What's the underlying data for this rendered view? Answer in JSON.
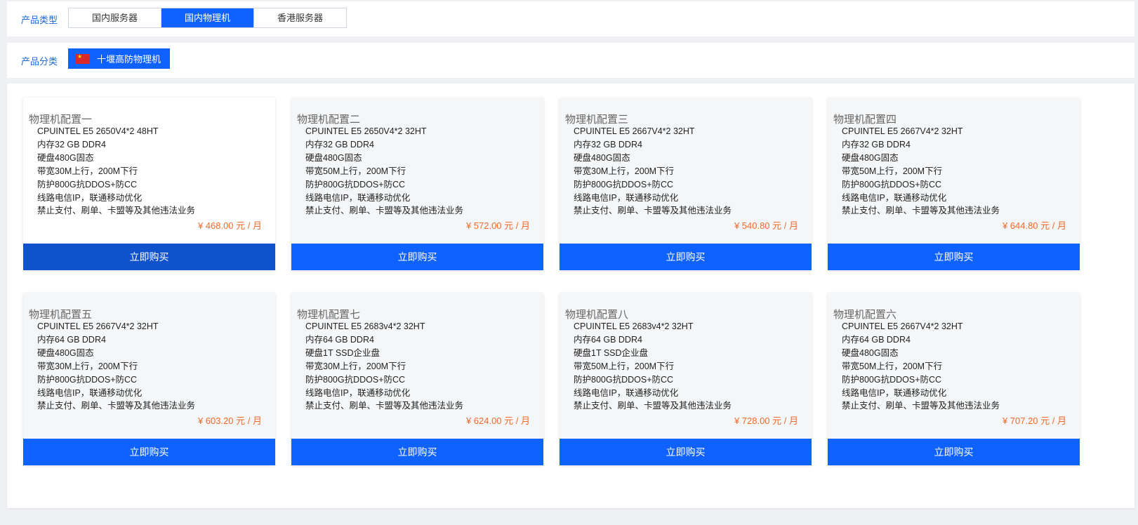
{
  "product_type": {
    "label": "产品类型",
    "tabs": [
      {
        "label": "国内服务器",
        "active": false
      },
      {
        "label": "国内物理机",
        "active": true
      },
      {
        "label": "香港服务器",
        "active": false
      }
    ]
  },
  "product_category": {
    "label": "产品分类",
    "selected": {
      "label": "十堰高防物理机",
      "icon": "china-flag-icon"
    }
  },
  "colors": {
    "accent": "#0f62fe",
    "price": "#f26a2a",
    "label": "#1e6ad6"
  },
  "cards": [
    {
      "title": "物理机配置一",
      "specs": [
        "CPUINTEL E5 2650V4*2 48HT",
        "内存32 GB DDR4",
        "硬盘480G固态",
        "带宽30M上行，200M下行",
        "防护800G抗DDOS+防CC",
        "线路电信IP，联通移动优化",
        "禁止支付、刷单、卡盟等及其他违法业务"
      ],
      "price": "¥ 468.00 元 / 月",
      "buy_label": "立即购买"
    },
    {
      "title": "物理机配置二",
      "specs": [
        "CPUINTEL E5 2650V4*2 32HT",
        "内存32 GB DDR4",
        "硬盘480G固态",
        "带宽50M上行，200M下行",
        "防护800G抗DDOS+防CC",
        "线路电信IP，联通移动优化",
        "禁止支付、刷单、卡盟等及其他违法业务"
      ],
      "price": "¥ 572.00 元 / 月",
      "buy_label": "立即购买"
    },
    {
      "title": "物理机配置三",
      "specs": [
        "CPUINTEL E5 2667V4*2 32HT",
        "内存32 GB DDR4",
        "硬盘480G固态",
        "带宽30M上行，200M下行",
        "防护800G抗DDOS+防CC",
        "线路电信IP，联通移动优化",
        "禁止支付、刷单、卡盟等及其他违法业务"
      ],
      "price": "¥ 540.80 元 / 月",
      "buy_label": "立即购买"
    },
    {
      "title": "物理机配置四",
      "specs": [
        "CPUINTEL E5 2667V4*2 32HT",
        "内存32 GB DDR4",
        "硬盘480G固态",
        "带宽50M上行，200M下行",
        "防护800G抗DDOS+防CC",
        "线路电信IP，联通移动优化",
        "禁止支付、刷单、卡盟等及其他违法业务"
      ],
      "price": "¥ 644.80 元 / 月",
      "buy_label": "立即购买"
    },
    {
      "title": "物理机配置五",
      "specs": [
        "CPUINTEL E5 2667V4*2 32HT",
        "内存64 GB DDR4",
        "硬盘480G固态",
        "带宽30M上行，200M下行",
        "防护800G抗DDOS+防CC",
        "线路电信IP，联通移动优化",
        "禁止支付、刷单、卡盟等及其他违法业务"
      ],
      "price": "¥ 603.20 元 / 月",
      "buy_label": "立即购买"
    },
    {
      "title": "物理机配置七",
      "specs": [
        "CPUINTEL E5 2683v4*2 32HT",
        "内存64 GB DDR4",
        "硬盘1T SSD企业盘",
        "带宽30M上行，200M下行",
        "防护800G抗DDOS+防CC",
        "线路电信IP，联通移动优化",
        "禁止支付、刷单、卡盟等及其他违法业务"
      ],
      "price": "¥ 624.00 元 / 月",
      "buy_label": "立即购买"
    },
    {
      "title": "物理机配置八",
      "specs": [
        "CPUINTEL E5 2683v4*2 32HT",
        "内存64 GB DDR4",
        "硬盘1T SSD企业盘",
        "带宽50M上行，200M下行",
        "防护800G抗DDOS+防CC",
        "线路电信IP，联通移动优化",
        "禁止支付、刷单、卡盟等及其他违法业务"
      ],
      "price": "¥ 728.00 元 / 月",
      "buy_label": "立即购买"
    },
    {
      "title": "物理机配置六",
      "specs": [
        "CPUINTEL E5 2667V4*2 32HT",
        "内存64 GB DDR4",
        "硬盘480G固态",
        "带宽50M上行，200M下行",
        "防护800G抗DDOS+防CC",
        "线路电信IP，联通移动优化",
        "禁止支付、刷单、卡盟等及其他违法业务"
      ],
      "price": "¥ 707.20 元 / 月",
      "buy_label": "立即购买"
    }
  ]
}
